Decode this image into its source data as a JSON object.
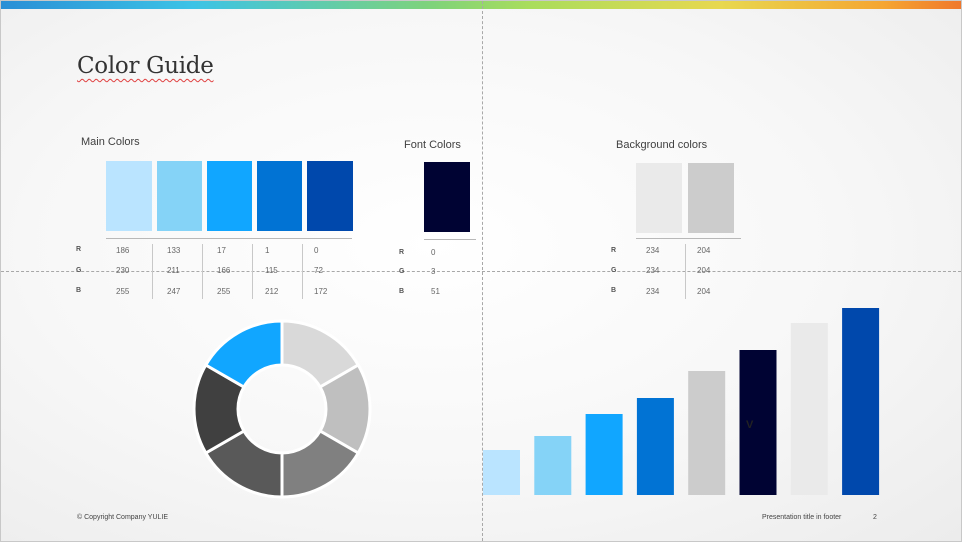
{
  "slide": {
    "title": "Color Guide",
    "footer_left": "© Copyright Company YULIE",
    "footer_right": "Presentation title in footer",
    "page_number": "2"
  },
  "main_colors": {
    "label": "Main Colors",
    "swatches": [
      "#BAE4FF",
      "#85D3F7",
      "#11A6FF",
      "#0173D4",
      "#0048AC"
    ],
    "r": [
      "186",
      "133",
      "17",
      "1",
      "0"
    ],
    "g": [
      "230",
      "211",
      "166",
      "115",
      "72"
    ],
    "b": [
      "255",
      "247",
      "255",
      "212",
      "172"
    ]
  },
  "font_colors": {
    "label": "Font Colors",
    "swatches": [
      "#000333"
    ],
    "r": [
      "0"
    ],
    "g": [
      "3"
    ],
    "b": [
      "51"
    ]
  },
  "background_colors": {
    "label": "Background colors",
    "swatches": [
      "#EAEAEA",
      "#CCCCCC"
    ],
    "r": [
      "234",
      "204"
    ],
    "g": [
      "234",
      "204"
    ],
    "b": [
      "234",
      "204"
    ]
  },
  "rgb_labels": {
    "r": "R",
    "g": "G",
    "b": "B"
  },
  "chart_data": [
    {
      "type": "pie",
      "variant": "doughnut",
      "values": [
        1,
        1,
        1,
        1,
        1,
        1
      ],
      "colors": [
        "#D9D9D9",
        "#BFBFBF",
        "#808080",
        "#595959",
        "#404040",
        "#11A6FF"
      ]
    },
    {
      "type": "bar",
      "values": [
        45,
        59,
        81,
        97,
        124,
        145,
        172,
        187
      ],
      "colors": [
        "#BAE4FF",
        "#85D3F7",
        "#11A6FF",
        "#0173D4",
        "#CCCCCC",
        "#000333",
        "#EAEAEA",
        "#0048AC"
      ],
      "annotation": "V"
    }
  ]
}
